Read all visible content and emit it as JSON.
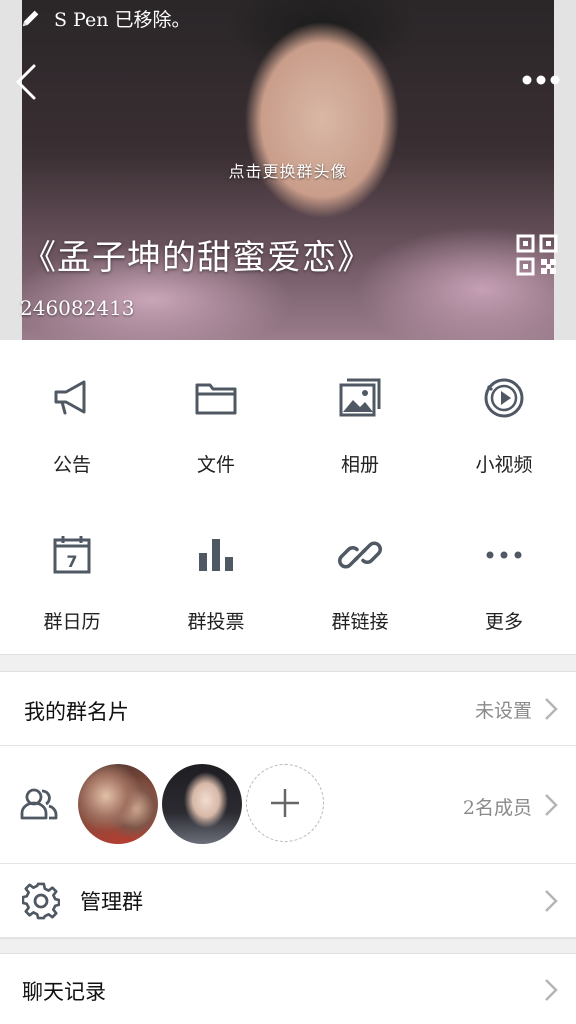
{
  "status_bar": {
    "text": "S Pen 已移除。",
    "icon": "pen-icon"
  },
  "header": {
    "change_avatar_text": "点击更换群头像",
    "group_name": "《孟子坤的甜蜜爱恋》",
    "group_id": "246082413"
  },
  "functions": [
    {
      "label": "公告",
      "icon": "megaphone-icon"
    },
    {
      "label": "文件",
      "icon": "folder-icon"
    },
    {
      "label": "相册",
      "icon": "photo-album-icon"
    },
    {
      "label": "小视频",
      "icon": "video-icon"
    },
    {
      "label": "群日历",
      "icon": "calendar-icon",
      "calendar_day": "7"
    },
    {
      "label": "群投票",
      "icon": "bar-chart-icon"
    },
    {
      "label": "群链接",
      "icon": "link-icon"
    },
    {
      "label": "更多",
      "icon": "ellipsis-icon"
    }
  ],
  "my_card": {
    "title": "我的群名片",
    "value": "未设置"
  },
  "members": {
    "count_text": "2名成员"
  },
  "manage": {
    "title": "管理群"
  },
  "chat_history": {
    "title": "聊天记录"
  },
  "colors": {
    "icon_gray": "#4f5863",
    "divider": "#e4e4e4",
    "gap_bg": "#f0f0f0"
  }
}
